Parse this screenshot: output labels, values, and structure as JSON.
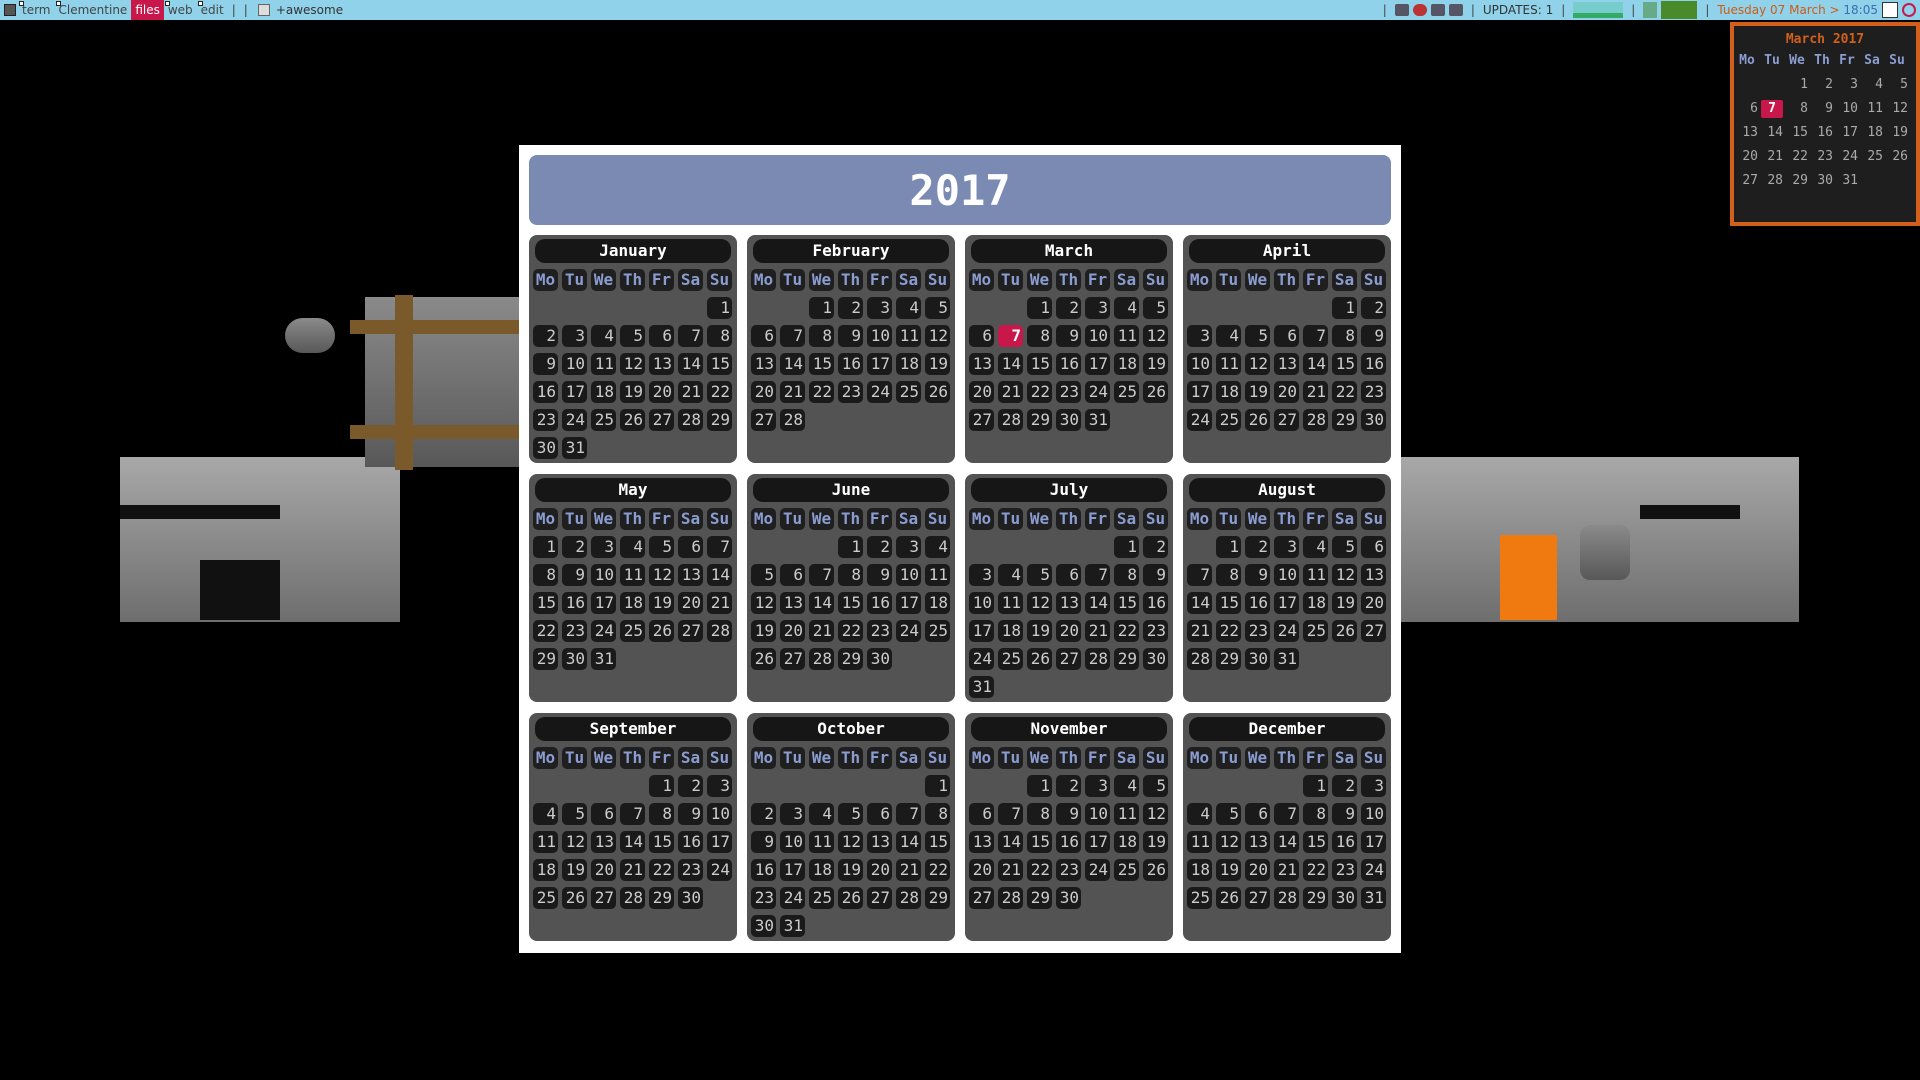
{
  "topbar": {
    "tags": [
      {
        "label": "term",
        "active": false
      },
      {
        "label": "Clementine",
        "active": false
      },
      {
        "label": "files",
        "active": true
      },
      {
        "label": "web",
        "active": false
      },
      {
        "label": "edit",
        "active": false
      }
    ],
    "separator": "|",
    "task_title": "+awesome",
    "updates_label": "UPDATES: 1",
    "date": "Tuesday 07 March",
    "gt": ">",
    "time": "18:05"
  },
  "colors": {
    "topbar": "#8fd2ea",
    "accent": "#c8174a",
    "title_bg": "#7a8ab2",
    "popup_border": "#d2601c"
  },
  "calendar": {
    "year": "2017",
    "weekdays": [
      "Mo",
      "Tu",
      "We",
      "Th",
      "Fr",
      "Sa",
      "Su"
    ],
    "today": {
      "month": 2,
      "day": 7
    },
    "months": [
      {
        "name": "January",
        "offset": 6,
        "days": 31
      },
      {
        "name": "February",
        "offset": 2,
        "days": 28
      },
      {
        "name": "March",
        "offset": 2,
        "days": 31
      },
      {
        "name": "April",
        "offset": 5,
        "days": 30
      },
      {
        "name": "May",
        "offset": 0,
        "days": 31
      },
      {
        "name": "June",
        "offset": 3,
        "days": 30
      },
      {
        "name": "July",
        "offset": 5,
        "days": 31
      },
      {
        "name": "August",
        "offset": 1,
        "days": 31
      },
      {
        "name": "September",
        "offset": 4,
        "days": 30
      },
      {
        "name": "October",
        "offset": 6,
        "days": 31
      },
      {
        "name": "November",
        "offset": 2,
        "days": 30
      },
      {
        "name": "December",
        "offset": 4,
        "days": 31
      }
    ]
  },
  "mini_calendar": {
    "title": "March 2017",
    "weekdays": [
      "Mo",
      "Tu",
      "We",
      "Th",
      "Fr",
      "Sa",
      "Su"
    ],
    "offset": 2,
    "days": 31,
    "today": 7
  }
}
